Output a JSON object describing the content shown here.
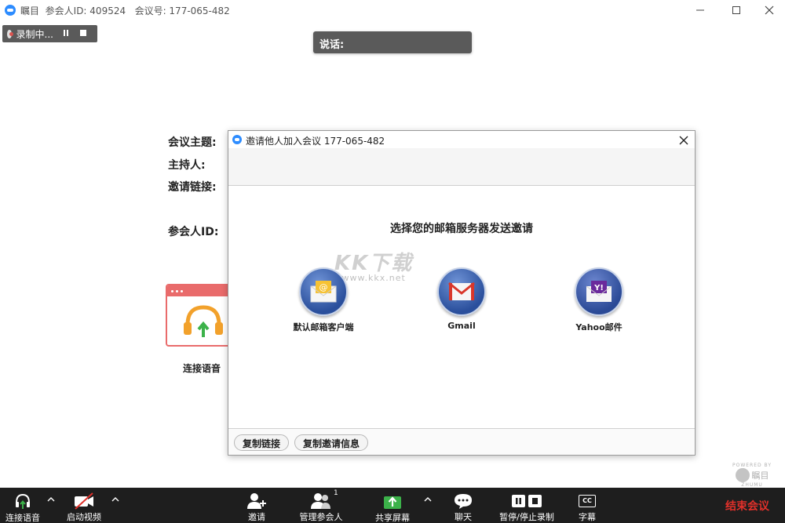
{
  "window": {
    "app_name": "瞩目",
    "participant_id_label": "参会人ID: 409524",
    "meeting_number_label": "会议号: 177-065-482"
  },
  "recording_pill": {
    "label": "录制中..."
  },
  "speaking": {
    "label": "说话:"
  },
  "meeting_info": {
    "topic_label": "会议主题:",
    "host_label": "主持人:",
    "invite_link_label": "邀请链接:",
    "participant_id_label": "参会人ID:"
  },
  "audio_card": {
    "label": "连接语音"
  },
  "dialog": {
    "title": "邀请他人加入会议 177-065-482",
    "heading": "选择您的邮箱服务器发送邀请",
    "options": [
      {
        "label": "默认邮箱客户端",
        "icon": "default-mail-icon"
      },
      {
        "label": "Gmail",
        "icon": "gmail-icon"
      },
      {
        "label": "Yahoo邮件",
        "icon": "yahoo-mail-icon"
      }
    ],
    "copy_link_label": "复制链接",
    "copy_invite_label": "复制邀请信息"
  },
  "watermark": {
    "big": "KK下载",
    "small": "www.kkx.net"
  },
  "powered": {
    "small": "POWERED BY",
    "brand": "瞩目",
    "brand_en": "ZHUMU"
  },
  "toolbar": {
    "join_audio": "连接语音",
    "start_video": "启动视频",
    "invite": "邀请",
    "manage_participants": "管理参会人",
    "participant_count": "1",
    "share_screen": "共享屏幕",
    "chat": "聊天",
    "pause_stop_recording": "暂停/停止录制",
    "captions": "字幕",
    "captions_icon_text": "CC",
    "end_meeting": "结束会议"
  },
  "colors": {
    "toolbar_bg": "#1e1e1e",
    "end_meeting": "#e0302a",
    "accent_blue": "#2d8cff",
    "share_green": "#3cb24a"
  }
}
